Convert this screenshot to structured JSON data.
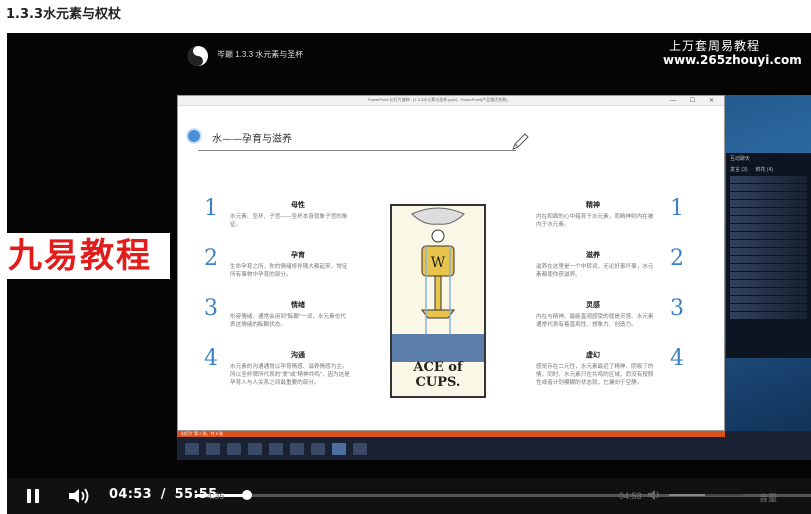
{
  "page": {
    "title": "1.3.3水元素与权杖"
  },
  "video": {
    "header_title": "岑巅 1.3.3 水元素与圣杯",
    "brand_name": "上万套周易教程",
    "brand_url": "www.265zhouyi.com",
    "watermark": "九易教程"
  },
  "ppt": {
    "window_title": "PowerPoint 幻灯片放映 - [1.3.3水元素与圣杯.pptx] - PowerPoint(产品激活失败)",
    "slide": {
      "heading": "水——孕育与滋养",
      "card_label": "ACE of CUPS.",
      "left_items": [
        {
          "num": "1",
          "title": "母性",
          "body": "水元素、圣杯、子宫——圣杯本身就象子宫的象征。"
        },
        {
          "num": "2",
          "title": "孕育",
          "body": "生命孕育之所，你的情绪将伴随大都起来，常征所有事物中孕育的部分。"
        },
        {
          "num": "3",
          "title": "情绪",
          "body": "形容情绪、通常会用到\"酝酿\"一词，水元素也代表这情绪的酝酿状态。"
        },
        {
          "num": "4",
          "title": "沟通",
          "body": "水元素的沟通通常以孕育情感、滋养情感为主。所以圣杯牌所代表的\"爱\"或\"精神共鸣\"，因为这是孕育人与人关系之间最重要的部分。"
        }
      ],
      "right_items": [
        {
          "num": "1",
          "title": "精神",
          "body": "内在和面的心中蕴育于水元素，而精神则内在被内于水元素。"
        },
        {
          "num": "2",
          "title": "滋养",
          "body": "滋养在这里是一个中转词，无论好事坏事，水元素都使你获滋养。"
        },
        {
          "num": "3",
          "title": "灵感",
          "body": "内在与精神、最能直观感受的就是灵感、水元素通常代表有着直观性、想象力、创造力。"
        },
        {
          "num": "4",
          "title": "虚幻",
          "body": "感觉存在二元性，水元素最近了精神、阴极了的情。同时，水元素只在共鸣的区域，而没有按照性或者计划模糊的状态就，它漏向于空静。"
        }
      ]
    },
    "status_strip": "幻灯片 第 2 张，共 8 张"
  },
  "chat": {
    "header": "互动聊天",
    "tabs": [
      "发言 (3)",
      "鲜花 (4)"
    ]
  },
  "controls": {
    "current_time": "04:53",
    "separator": "/",
    "total_time": "55:55",
    "progress": 0.085,
    "ghost_time_left": "4:36",
    "ghost_time_right": "04:53",
    "ghost_vol_label": "音量"
  }
}
